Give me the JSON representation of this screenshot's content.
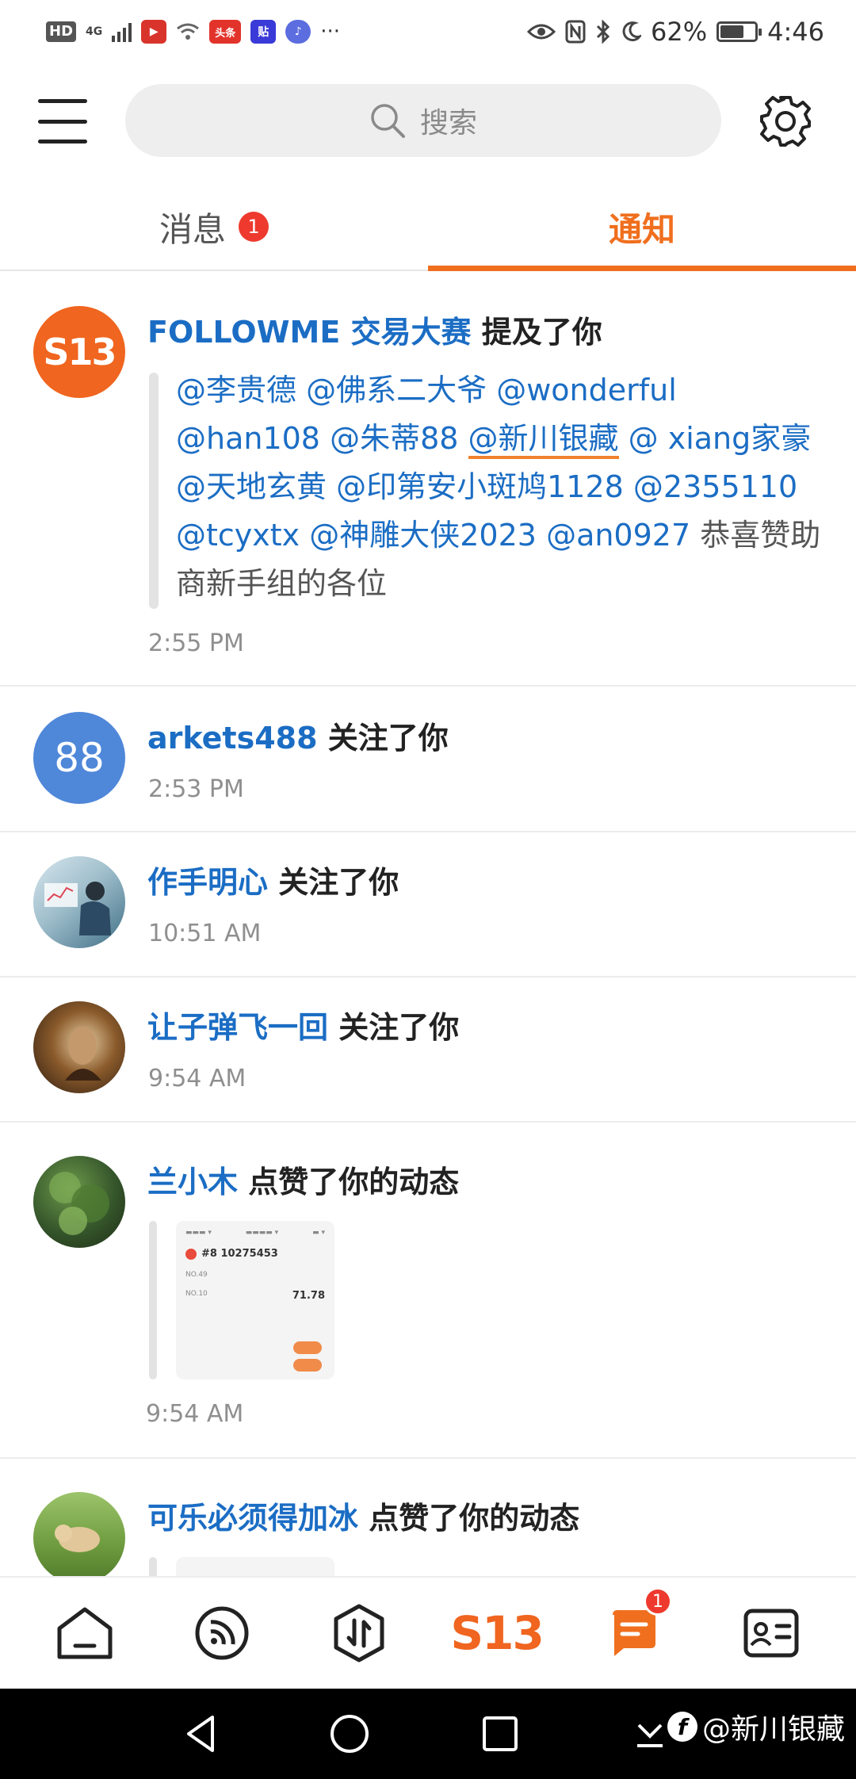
{
  "status_bar": {
    "hd": "HD",
    "network": "4G",
    "app_badge_1": "头条",
    "app_badge_2": "贴",
    "more": "···",
    "battery": "62%",
    "time": "4:46",
    "battery_level": 0.62
  },
  "header": {
    "search_placeholder": "搜索"
  },
  "tabs": [
    {
      "label": "消息",
      "badge": "1",
      "active": false
    },
    {
      "label": "通知",
      "active": true
    }
  ],
  "feed": [
    {
      "avatar_text": "S13",
      "user": "FOLLOWME 交易大赛",
      "action": "提及了你",
      "mentions": [
        "@李贵德",
        "@佛系二大爷",
        "@wonderful",
        "@han108",
        "@朱蒂88",
        "@新川银藏",
        "@ xiang家豪",
        "@天地玄黄",
        "@印第安小斑鸠1128",
        "@2355110",
        "@tcyxtx",
        "@神雕大侠2023",
        "@an0927"
      ],
      "message_tail": "恭喜赞助商新手组的各位",
      "time": "2:55 PM"
    },
    {
      "avatar_text": "88",
      "user": "arkets488",
      "action": "关注了你",
      "time": "2:53 PM"
    },
    {
      "user": "作手明心",
      "action": "关注了你",
      "time": "10:51 AM"
    },
    {
      "user": "让子弹飞一回",
      "action": "关注了你",
      "time": "9:54 AM"
    },
    {
      "user": "兰小木",
      "action": "点赞了你的动态",
      "time": "9:54 AM",
      "thumb": {
        "id": "#8 10275453",
        "a": "NO.49",
        "b": "NO.10",
        "score": "71.78"
      }
    },
    {
      "user": "可乐必须得加冰",
      "action": "点赞了你的动态"
    }
  ],
  "bottom_nav": {
    "s13_label": "S13",
    "messages_badge": "1"
  },
  "watermark": "@新川银藏",
  "colors": {
    "accent": "#f06f1e",
    "link": "#1b6dc4",
    "badge": "#ee3a2e"
  }
}
